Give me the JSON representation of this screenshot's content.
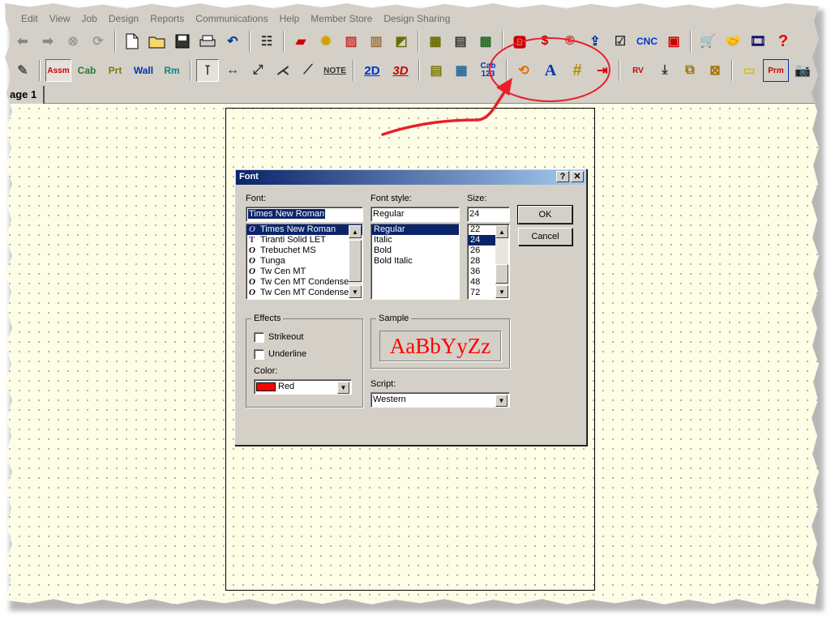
{
  "menu": [
    "Edit",
    "View",
    "Job",
    "Design",
    "Reports",
    "Communications",
    "Help",
    "Member Store",
    "Design Sharing"
  ],
  "toolbar2": {
    "assm": "Assm",
    "cab": "Cab",
    "prt": "Prt",
    "wall": "Wall",
    "rm": "Rm",
    "note": "NOTE",
    "view2d": "2D",
    "view3d": "3D",
    "cab123": "Cab 123",
    "font_tool": "A",
    "rv": "RV",
    "prm": "Prm"
  },
  "toolbar1": {
    "cnc": "CNC"
  },
  "tab": {
    "label": "age 1"
  },
  "dialog": {
    "title": "Font",
    "help_btn": "?",
    "close_btn": "✕",
    "font_label": "Font:",
    "font_value": "Times New Roman",
    "fonts": [
      "Times New Roman",
      "Tiranti Solid LET",
      "Trebuchet MS",
      "Tunga",
      "Tw Cen MT",
      "Tw Cen MT Condensed",
      "Tw Cen MT Condensed"
    ],
    "font_icons": [
      "O",
      "T",
      "O",
      "O",
      "O",
      "O",
      "O"
    ],
    "style_label": "Font style:",
    "style_value": "Regular",
    "styles": [
      "Regular",
      "Italic",
      "Bold",
      "Bold Italic"
    ],
    "size_label": "Size:",
    "size_value": "24",
    "sizes": [
      "22",
      "24",
      "26",
      "28",
      "36",
      "48",
      "72"
    ],
    "ok": "OK",
    "cancel": "Cancel",
    "effects_label": "Effects",
    "strikeout": "Strikeout",
    "underline": "Underline",
    "color_label": "Color:",
    "color_value": "Red",
    "color_hex": "#ff0000",
    "sample_label": "Sample",
    "sample_text": "AaBbYyZz",
    "script_label": "Script:",
    "script_value": "Western"
  },
  "colors": {
    "title_start": "#0a246a",
    "title_end": "#a6caf0",
    "annotation": "#e8202a",
    "canvas": "#fefee6"
  }
}
